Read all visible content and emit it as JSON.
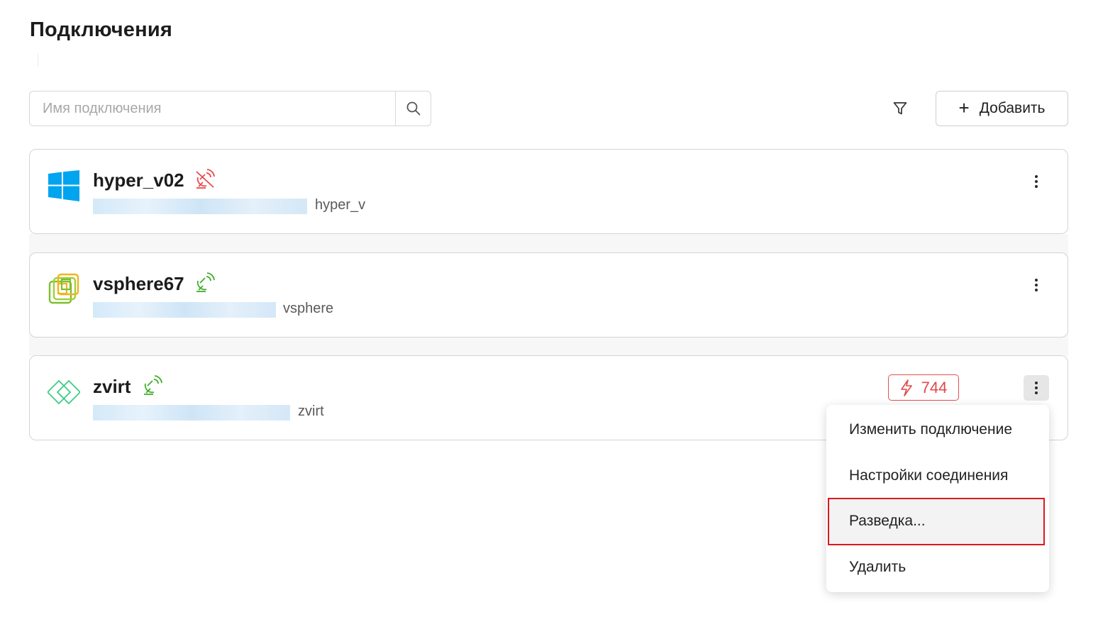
{
  "page": {
    "title": "Подключения"
  },
  "search": {
    "placeholder": "Имя подключения"
  },
  "toolbar": {
    "add_label": "Добавить",
    "add_icon": "plus-icon",
    "filter_icon": "filter-icon"
  },
  "connections": [
    {
      "name": "hyper_v02",
      "type": "hyper_v",
      "logo": "windows-logo",
      "status": "disconnected",
      "status_color": "#e84a4a"
    },
    {
      "name": "vsphere67",
      "type": "vsphere",
      "logo": "vsphere-logo",
      "status": "connected",
      "status_color": "#3fae2a"
    },
    {
      "name": "zvirt",
      "type": "zvirt",
      "logo": "zvirt-logo",
      "status": "connected",
      "status_color": "#3fae2a",
      "alerts": "744"
    }
  ],
  "context_menu": {
    "items": [
      {
        "label": "Изменить подключение"
      },
      {
        "label": "Настройки соединения"
      },
      {
        "label": "Разведка..."
      },
      {
        "label": "Удалить"
      }
    ]
  },
  "colors": {
    "error": "#e04848",
    "success": "#3fae2a",
    "windows_blue": "#00a4ef",
    "highlight_border": "#e0171e"
  }
}
